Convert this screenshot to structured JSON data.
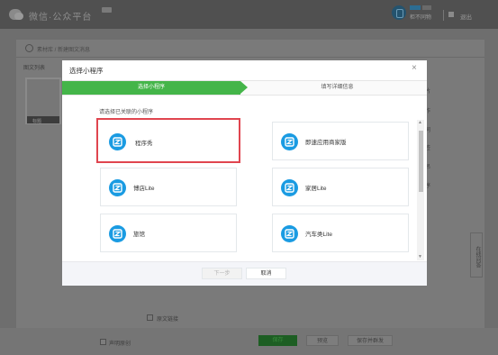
{
  "background": {
    "logo_text": "微信·公众平台",
    "account_name": "柜不同物",
    "logout_label": "退出",
    "breadcrumb": "素材库 / 新建图文消息",
    "sidebar_title": "图文列表",
    "thumb_label": "标题",
    "right_panel_items": [
      "片",
      "作",
      "同",
      "签",
      "吊",
      "序"
    ],
    "float_tab_label": "在线问答",
    "original_label": "原文链接",
    "declare_label": "声明原创",
    "save_button": "保存",
    "preview_button": "预览",
    "publish_button": "保存并群发"
  },
  "modal": {
    "title": "选择小程序",
    "close_icon": "×",
    "steps": [
      "选择小程序",
      "填写详细信息"
    ],
    "active_step": 1,
    "section_label": "请选择已关联的小程序",
    "apps": [
      {
        "name": "程序秀",
        "selected": true
      },
      {
        "name": "即速应用商家版",
        "selected": false
      },
      {
        "name": "博店Lite",
        "selected": false
      },
      {
        "name": "家居Lite",
        "selected": false
      },
      {
        "name": "旅馆",
        "selected": false
      },
      {
        "name": "汽车类Lite",
        "selected": false
      }
    ],
    "next_button": "下一步",
    "cancel_button": "取消"
  },
  "colors": {
    "accent_green": "#44b549",
    "selection_red": "#e0454f",
    "app_icon_blue": "#1a9be2"
  },
  "icons": {
    "app_icon": "miniprogram-z-icon",
    "close": "close-icon",
    "scroll_up": "scroll-up-arrow-icon",
    "scroll_down": "scroll-down-arrow-icon"
  }
}
